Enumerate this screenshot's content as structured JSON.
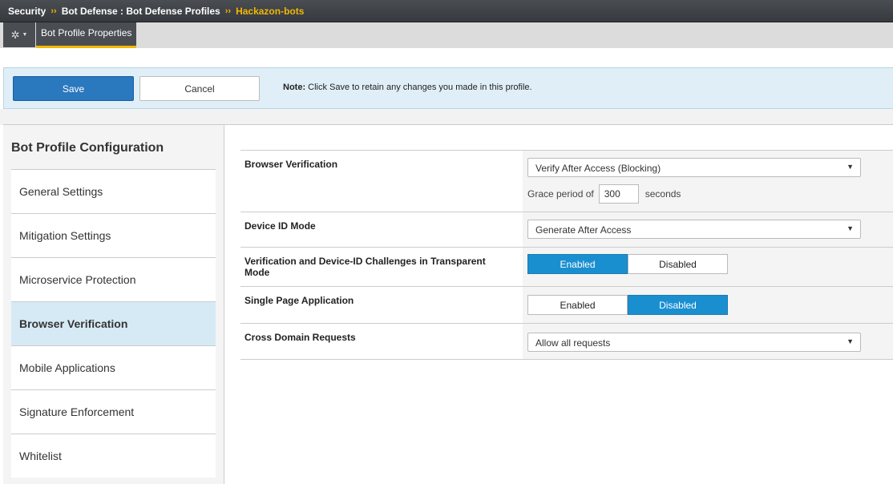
{
  "breadcrumb": {
    "part1": "Security",
    "sep1": "››",
    "part2": "Bot Defense : Bot Defense Profiles",
    "sep2": "››",
    "current": "Hackazon-bots"
  },
  "tabs": {
    "gear_icon": "gear-icon",
    "active_tab": "Bot Profile Properties"
  },
  "actions": {
    "save_label": "Save",
    "cancel_label": "Cancel",
    "note_bold": "Note:",
    "note_text": " Click Save to retain any changes you made in this profile."
  },
  "sidebar": {
    "title": "Bot Profile Configuration",
    "items": [
      {
        "label": "General Settings"
      },
      {
        "label": "Mitigation Settings"
      },
      {
        "label": "Microservice Protection"
      },
      {
        "label": "Browser Verification",
        "active": true
      },
      {
        "label": "Mobile Applications"
      },
      {
        "label": "Signature Enforcement"
      },
      {
        "label": "Whitelist"
      }
    ]
  },
  "settings": {
    "browser_verification": {
      "label": "Browser Verification",
      "value": "Verify After Access (Blocking)",
      "grace_prefix": "Grace period of",
      "grace_value": "300",
      "grace_suffix": "seconds"
    },
    "device_id_mode": {
      "label": "Device ID Mode",
      "value": "Generate After Access"
    },
    "transparent_challenges": {
      "label": "Verification and Device-ID Challenges in Transparent Mode",
      "enabled_label": "Enabled",
      "disabled_label": "Disabled",
      "selected": "Enabled"
    },
    "single_page_app": {
      "label": "Single Page Application",
      "enabled_label": "Enabled",
      "disabled_label": "Disabled",
      "selected": "Disabled"
    },
    "cross_domain": {
      "label": "Cross Domain Requests",
      "value": "Allow all requests"
    }
  },
  "colors": {
    "accent_blue": "#2a78be",
    "toggle_on": "#1a8fd0",
    "highlight_yellow": "#f2b705",
    "active_nav": "#d6eaf5"
  }
}
